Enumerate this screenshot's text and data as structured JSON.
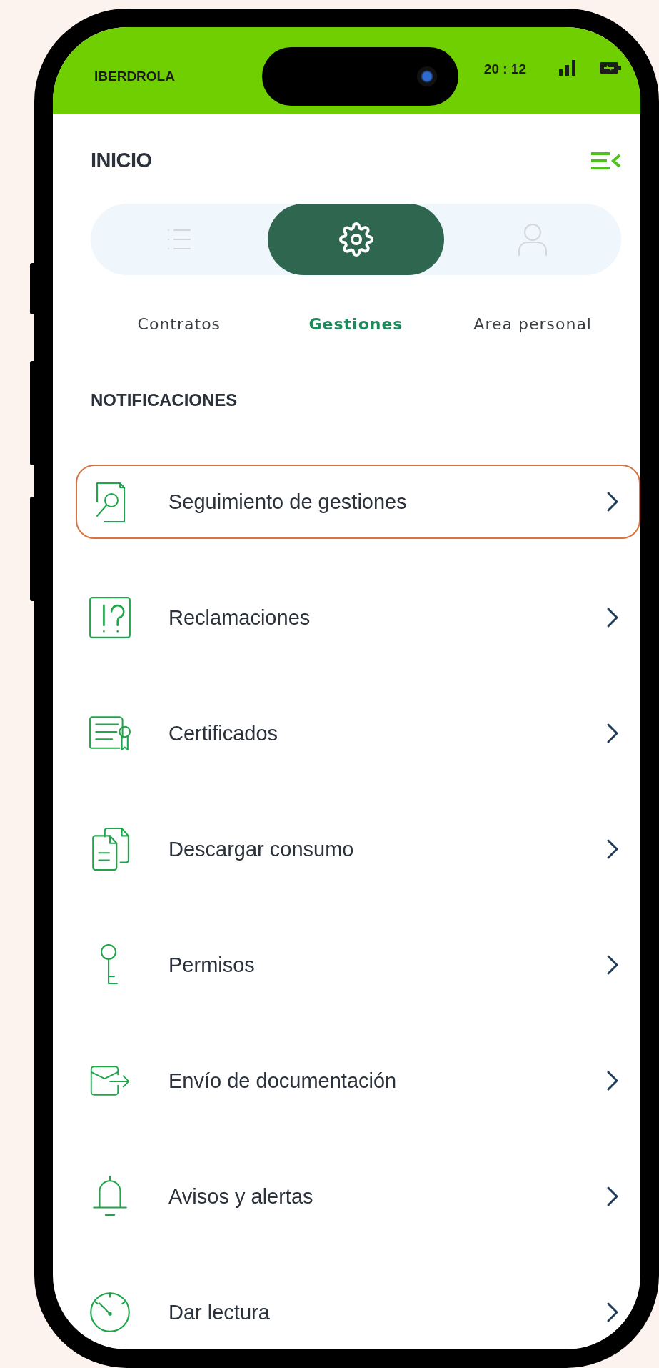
{
  "status_bar": {
    "carrier": "IBERDROLA",
    "time": "20 : 12"
  },
  "header": {
    "title": "INICIO"
  },
  "tabs": [
    {
      "label": "Contratos",
      "selected": false
    },
    {
      "label": "Gestiones",
      "selected": true
    },
    {
      "label": "Area personal",
      "selected": false
    }
  ],
  "section_title": "NOTIFICACIONES",
  "items": [
    {
      "label": "Seguimiento de gestiones",
      "selected": true
    },
    {
      "label": "Reclamaciones",
      "selected": false
    },
    {
      "label": "Certificados",
      "selected": false
    },
    {
      "label": "Descargar consumo",
      "selected": false
    },
    {
      "label": "Permisos",
      "selected": false
    },
    {
      "label": "Envío de documentación",
      "selected": false
    },
    {
      "label": "Avisos y alertas",
      "selected": false
    },
    {
      "label": "Dar lectura",
      "selected": false
    }
  ]
}
